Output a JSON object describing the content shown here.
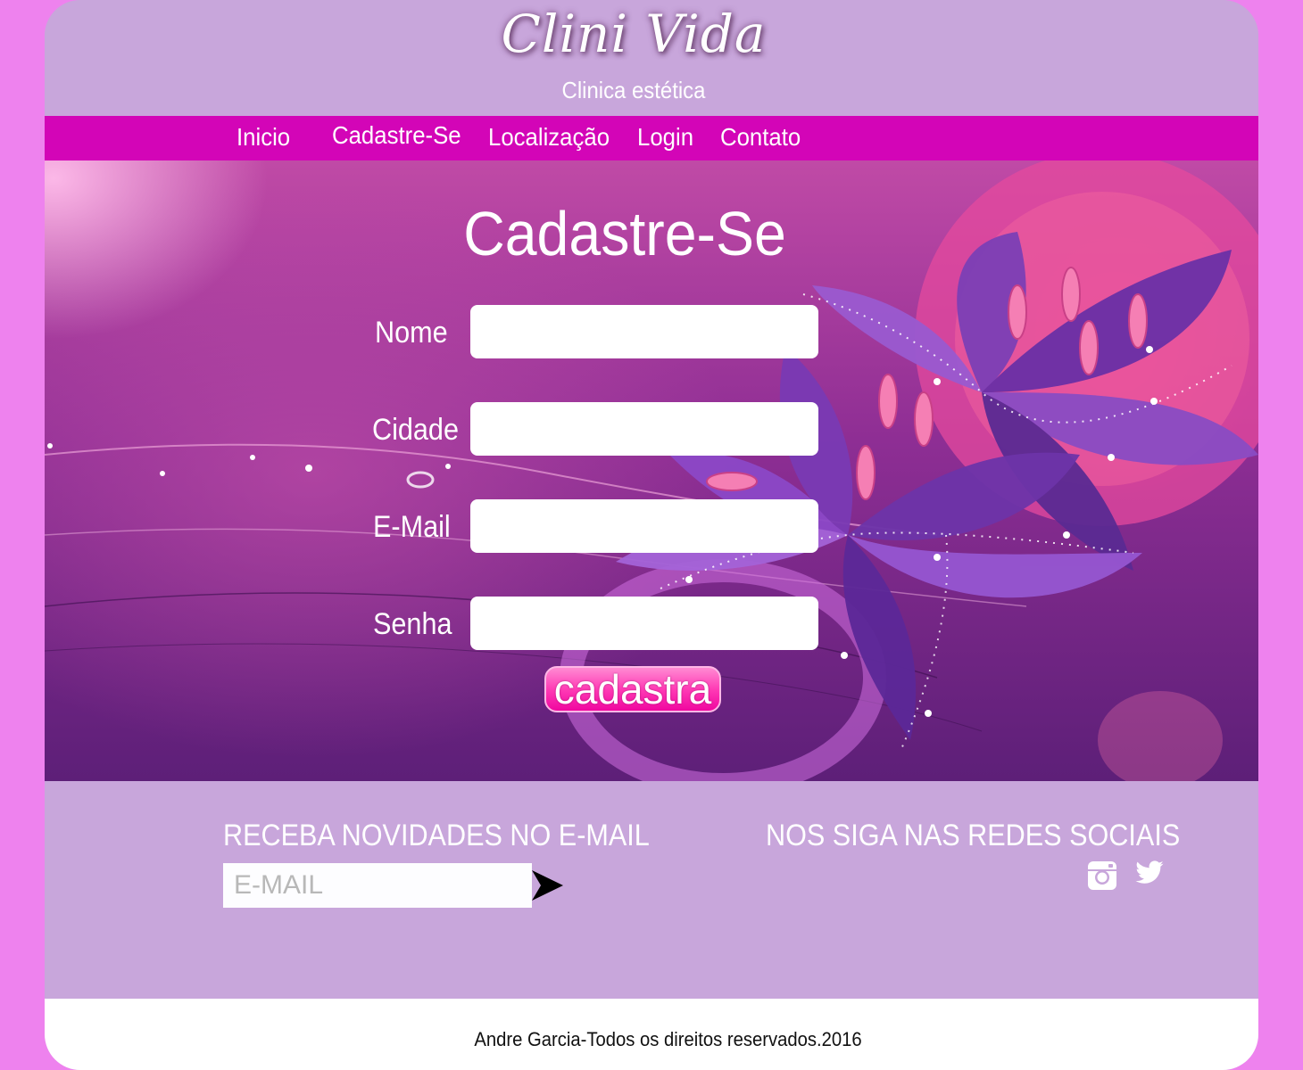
{
  "header": {
    "logo": "Clini Vida",
    "tagline": "Clinica estética"
  },
  "nav": {
    "items": [
      "Inicio",
      "Cadastre-Se",
      "Localização",
      "Login",
      "Contato"
    ]
  },
  "form": {
    "title": "Cadastre-Se",
    "fields": [
      {
        "label": "Nome",
        "value": ""
      },
      {
        "label": "Cidade",
        "value": ""
      },
      {
        "label": "E-Mail",
        "value": ""
      },
      {
        "label": "Senha",
        "value": ""
      }
    ],
    "submit_label": "cadastra"
  },
  "footer": {
    "newsletter_title": "RECEBA NOVIDADES NO E-MAIL",
    "newsletter_placeholder": "E-MAIL",
    "social_title": "NOS SIGA NAS REDES SOCIAIS",
    "social_icons": [
      "instagram-icon",
      "twitter-icon"
    ],
    "copyright": "Andre Garcia-Todos os direitos reservados.2016"
  },
  "colors": {
    "page_background": "#ee82ee",
    "header_background": "#c8a6db",
    "nav_background": "#d305b7",
    "button_pink": "#ff3bb5",
    "copyright_background": "#ffffff"
  }
}
